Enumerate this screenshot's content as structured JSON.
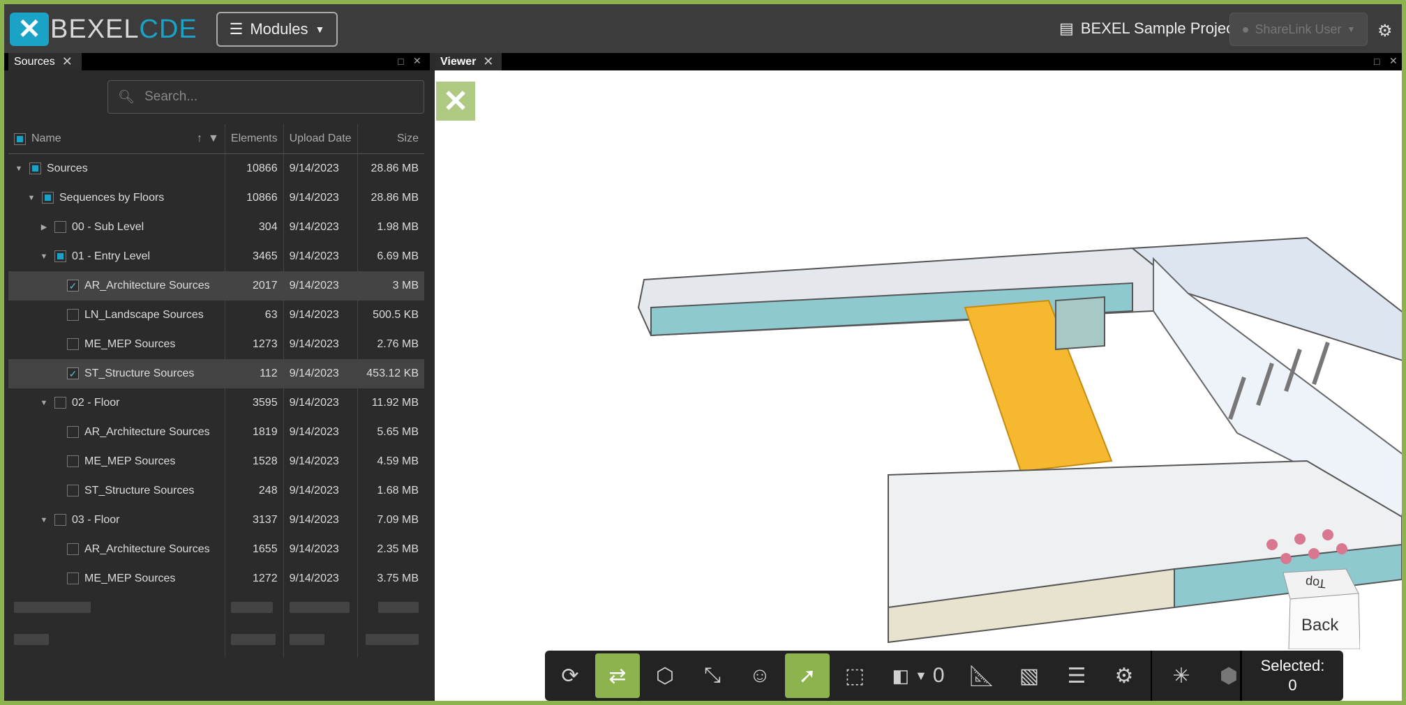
{
  "header": {
    "logo_text_a": "BEXEL",
    "logo_text_b": "CDE",
    "modules_label": "Modules",
    "project_name": "BEXEL Sample Project",
    "user_label": "ShareLink User"
  },
  "sources_panel": {
    "tab_title": "Sources",
    "search_placeholder": "Search...",
    "columns": [
      "Name",
      "Elements",
      "Upload Date",
      "Size"
    ],
    "rows": [
      {
        "name": "Sources",
        "elements": "10866",
        "date": "9/14/2023",
        "size": "28.86 MB",
        "level": 0,
        "expanded": true,
        "check": "partial",
        "selected": false
      },
      {
        "name": "Sequences by Floors",
        "elements": "10866",
        "date": "9/14/2023",
        "size": "28.86 MB",
        "level": 1,
        "expanded": true,
        "check": "partial",
        "selected": false
      },
      {
        "name": "00 - Sub Level",
        "elements": "304",
        "date": "9/14/2023",
        "size": "1.98 MB",
        "level": 2,
        "expanded": false,
        "check": "none",
        "selected": false
      },
      {
        "name": "01 - Entry Level",
        "elements": "3465",
        "date": "9/14/2023",
        "size": "6.69 MB",
        "level": 2,
        "expanded": true,
        "check": "partial",
        "selected": false
      },
      {
        "name": "AR_Architecture Sources",
        "elements": "2017",
        "date": "9/14/2023",
        "size": "3 MB",
        "level": 3,
        "check": "checked",
        "selected": true
      },
      {
        "name": "LN_Landscape Sources",
        "elements": "63",
        "date": "9/14/2023",
        "size": "500.5 KB",
        "level": 3,
        "check": "none",
        "selected": false
      },
      {
        "name": "ME_MEP Sources",
        "elements": "1273",
        "date": "9/14/2023",
        "size": "2.76 MB",
        "level": 3,
        "check": "none",
        "selected": false
      },
      {
        "name": "ST_Structure Sources",
        "elements": "112",
        "date": "9/14/2023",
        "size": "453.12 KB",
        "level": 3,
        "check": "checked",
        "selected": true
      },
      {
        "name": "02 - Floor",
        "elements": "3595",
        "date": "9/14/2023",
        "size": "11.92 MB",
        "level": 2,
        "expanded": true,
        "check": "none",
        "selected": false
      },
      {
        "name": "AR_Architecture Sources",
        "elements": "1819",
        "date": "9/14/2023",
        "size": "5.65 MB",
        "level": 3,
        "check": "none",
        "selected": false
      },
      {
        "name": "ME_MEP Sources",
        "elements": "1528",
        "date": "9/14/2023",
        "size": "4.59 MB",
        "level": 3,
        "check": "none",
        "selected": false
      },
      {
        "name": "ST_Structure Sources",
        "elements": "248",
        "date": "9/14/2023",
        "size": "1.68 MB",
        "level": 3,
        "check": "none",
        "selected": false
      },
      {
        "name": "03 - Floor",
        "elements": "3137",
        "date": "9/14/2023",
        "size": "7.09 MB",
        "level": 2,
        "expanded": true,
        "check": "none",
        "selected": false
      },
      {
        "name": "AR_Architecture Sources",
        "elements": "1655",
        "date": "9/14/2023",
        "size": "2.35 MB",
        "level": 3,
        "check": "none",
        "selected": false
      },
      {
        "name": "ME_MEP Sources",
        "elements": "1272",
        "date": "9/14/2023",
        "size": "3.75 MB",
        "level": 3,
        "check": "none",
        "selected": false
      }
    ]
  },
  "viewer": {
    "tab_title": "Viewer",
    "view_cube_labels": [
      "Top",
      "Back"
    ],
    "level_value": "0",
    "selected_label": "Selected:",
    "selected_count": "0",
    "toolbar_icons": [
      "orbit-icon",
      "sync-views-icon",
      "isometric-view-icon",
      "fit-all-icon",
      "walk-person-icon",
      "select-pointer-icon",
      "box-select-icon",
      "section-level-icon",
      "measure-icon",
      "snapshot-icon",
      "properties-list-icon",
      "settings-icon",
      "explode-icon",
      "hide-show-icon"
    ]
  },
  "colors": {
    "accent": "#8db34e",
    "brand_blue": "#1aa3c7",
    "highlight": "#f5b82e"
  }
}
